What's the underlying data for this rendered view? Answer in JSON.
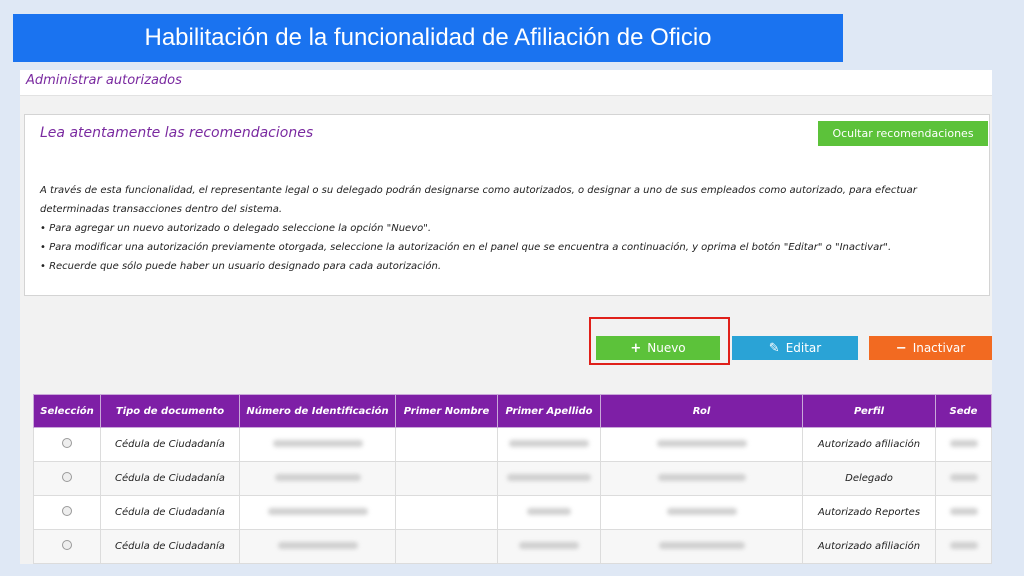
{
  "title": "Habilitación de la funcionalidad de Afiliación de Oficio",
  "page": {
    "header": "Administrar autorizados"
  },
  "recommendations": {
    "title": "Lea atentamente las recomendaciones",
    "hide_button": "Ocultar recomendaciones",
    "intro": "A través de esta funcionalidad, el representante legal o su delegado podrán designarse como autorizados, o designar a uno de sus empleados como autorizado, para efectuar determinadas transacciones dentro del sistema.",
    "bullets": [
      "• Para agregar un nuevo autorizado o delegado seleccione la opción \"Nuevo\".",
      "• Para modificar una autorización previamente otorgada, seleccione la autorización en el panel que se encuentra a continuación, y oprima el botón \"Editar\" o \"Inactivar\".",
      "• Recuerde que sólo puede haber un usuario designado para cada autorización."
    ]
  },
  "actions": {
    "new": "Nuevo",
    "edit": "Editar",
    "inactivate": "Inactivar"
  },
  "table": {
    "headers": [
      "Selección",
      "Tipo de documento",
      "Número de Identificación",
      "Primer Nombre",
      "Primer Apellido",
      "Rol",
      "Perfil",
      "Sede"
    ],
    "rows": [
      {
        "tipo": "Cédula de Ciudadanía",
        "perfil": "Autorizado afiliación"
      },
      {
        "tipo": "Cédula de Ciudadanía",
        "perfil": "Delegado"
      },
      {
        "tipo": "Cédula de Ciudadanía",
        "perfil": "Autorizado Reportes"
      },
      {
        "tipo": "Cédula de Ciudadanía",
        "perfil": "Autorizado afiliación"
      }
    ]
  },
  "colors": {
    "banner": "#1a73f0",
    "header_purple": "#7e1fa6",
    "green": "#5cc23a",
    "blue": "#2aa3d6",
    "orange": "#f26a21",
    "highlight": "#e0201a"
  },
  "icons": {
    "new": "plus-icon",
    "edit": "pencil-icon",
    "inactivate": "minus-icon"
  }
}
